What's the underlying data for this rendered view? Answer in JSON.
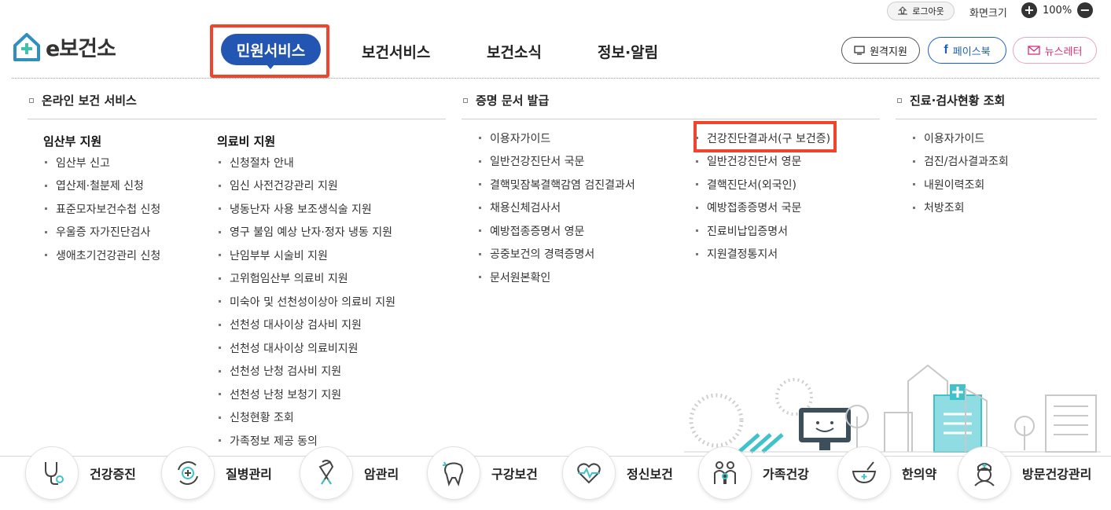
{
  "utility": {
    "logout_label": "로그아웃",
    "screen_size_label": "화면크기",
    "zoom_value": "100%"
  },
  "logo": {
    "text": "e보건소"
  },
  "gnb": {
    "items": [
      {
        "label": "민원서비스"
      },
      {
        "label": "보건서비스"
      },
      {
        "label": "보건소식"
      },
      {
        "label": "정보·알림"
      }
    ]
  },
  "header_buttons": {
    "remote_support": "원격지원",
    "facebook": "페이스북",
    "newsletter": "뉴스레터"
  },
  "mega": {
    "online": {
      "title": "온라인 보건 서비스",
      "group1": {
        "title": "임산부 지원",
        "items": [
          "임산부 신고",
          "엽산제·철분제 신청",
          "표준모자보건수첩 신청",
          "우울증 자가진단검사",
          "생애초기건강관리 신청"
        ]
      },
      "group2": {
        "title": "의료비 지원",
        "items": [
          "신청절차 안내",
          "임신 사전건강관리 지원",
          "냉동난자 사용 보조생식술 지원",
          "영구 불임 예상 난자·정자 냉동 지원",
          "난임부부 시술비 지원",
          "고위험임산부 의료비 지원",
          "미숙아 및 선천성이상아 의료비 지원",
          "선천성 대사이상 검사비 지원",
          "선천성 대사이상 의료비지원",
          "선천성 난청 검사비 지원",
          "선천성 난청 보청기 지원",
          "신청현황 조회",
          "가족정보 제공 동의"
        ]
      }
    },
    "cert": {
      "title": "증명 문서 발급",
      "col1": [
        "이용자가이드",
        "일반건강진단서 국문",
        "결핵및잠복결핵감염 검진결과서",
        "채용신체검사서",
        "예방접종증명서 영문",
        "공중보건의 경력증명서",
        "문서원본확인"
      ],
      "col2": [
        "건강진단결과서(구 보건증)",
        "일반건강진단서 영문",
        "결핵진단서(외국인)",
        "예방접종증명서 국문",
        "진료비납입증명서",
        "지원결정통지서"
      ]
    },
    "exam": {
      "title": "진료·검사현황 조회",
      "items": [
        "이용자가이드",
        "검진/검사결과조회",
        "내원이력조회",
        "처방조회"
      ]
    }
  },
  "quick_menu": [
    {
      "label": "건강증진",
      "icon": "stethoscope-icon"
    },
    {
      "label": "질병관리",
      "icon": "virus-cycle-icon"
    },
    {
      "label": "암관리",
      "icon": "ribbon-icon"
    },
    {
      "label": "구강보건",
      "icon": "tooth-icon"
    },
    {
      "label": "정신보건",
      "icon": "heart-pulse-icon"
    },
    {
      "label": "가족건강",
      "icon": "family-icon"
    },
    {
      "label": "한의약",
      "icon": "mortar-icon"
    },
    {
      "label": "방문건강관리",
      "icon": "nurse-icon"
    }
  ],
  "colors": {
    "brand_blue": "#2355b2",
    "highlight_red": "#f0442c",
    "teal": "#3fc2c9",
    "facebook_blue": "#1d5fbf",
    "newsletter_pink": "#d7307a"
  }
}
